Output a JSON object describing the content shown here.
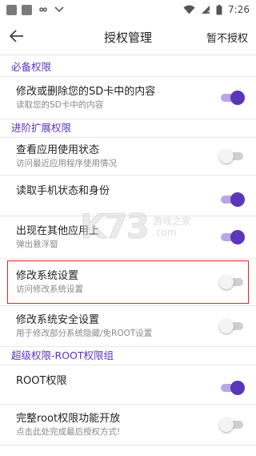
{
  "status_bar": {
    "time": "7:26"
  },
  "app_bar": {
    "title": "授权管理",
    "action_label": "暂不授权"
  },
  "sections": [
    {
      "header": "必备权限",
      "items": [
        {
          "title": "修改或删除您的SD卡中的内容",
          "subtitle": "读取您的SD卡中的内容",
          "enabled": true
        }
      ]
    },
    {
      "header": "进阶扩展权限",
      "items": [
        {
          "title": "查看应用使用状态",
          "subtitle": "访问最近应用程序使用情况",
          "enabled": false
        },
        {
          "title": "读取手机状态和身份",
          "subtitle": "",
          "enabled": true
        },
        {
          "title": "出现在其他应用上",
          "subtitle": "弹出悬浮窗",
          "enabled": true
        },
        {
          "title": "修改系统设置",
          "subtitle": "访问修改系统设置",
          "enabled": false
        },
        {
          "title": "修改系统安全设置",
          "subtitle": "用于修改部分系统隐藏/免ROOT设置",
          "enabled": false
        }
      ]
    },
    {
      "header": "超级权限-ROOT权限组",
      "items": [
        {
          "title": "ROOT权限",
          "subtitle": "",
          "enabled": true
        },
        {
          "title": "完整root权限功能开放",
          "subtitle": "点击此处完成最后授权方式!",
          "enabled": false
        }
      ]
    }
  ],
  "watermark": {
    "logo": "K73",
    "line1": "游戏之家",
    "line2": ".com"
  },
  "colors": {
    "accent": "#5a36b8",
    "highlight": "#e02424"
  }
}
